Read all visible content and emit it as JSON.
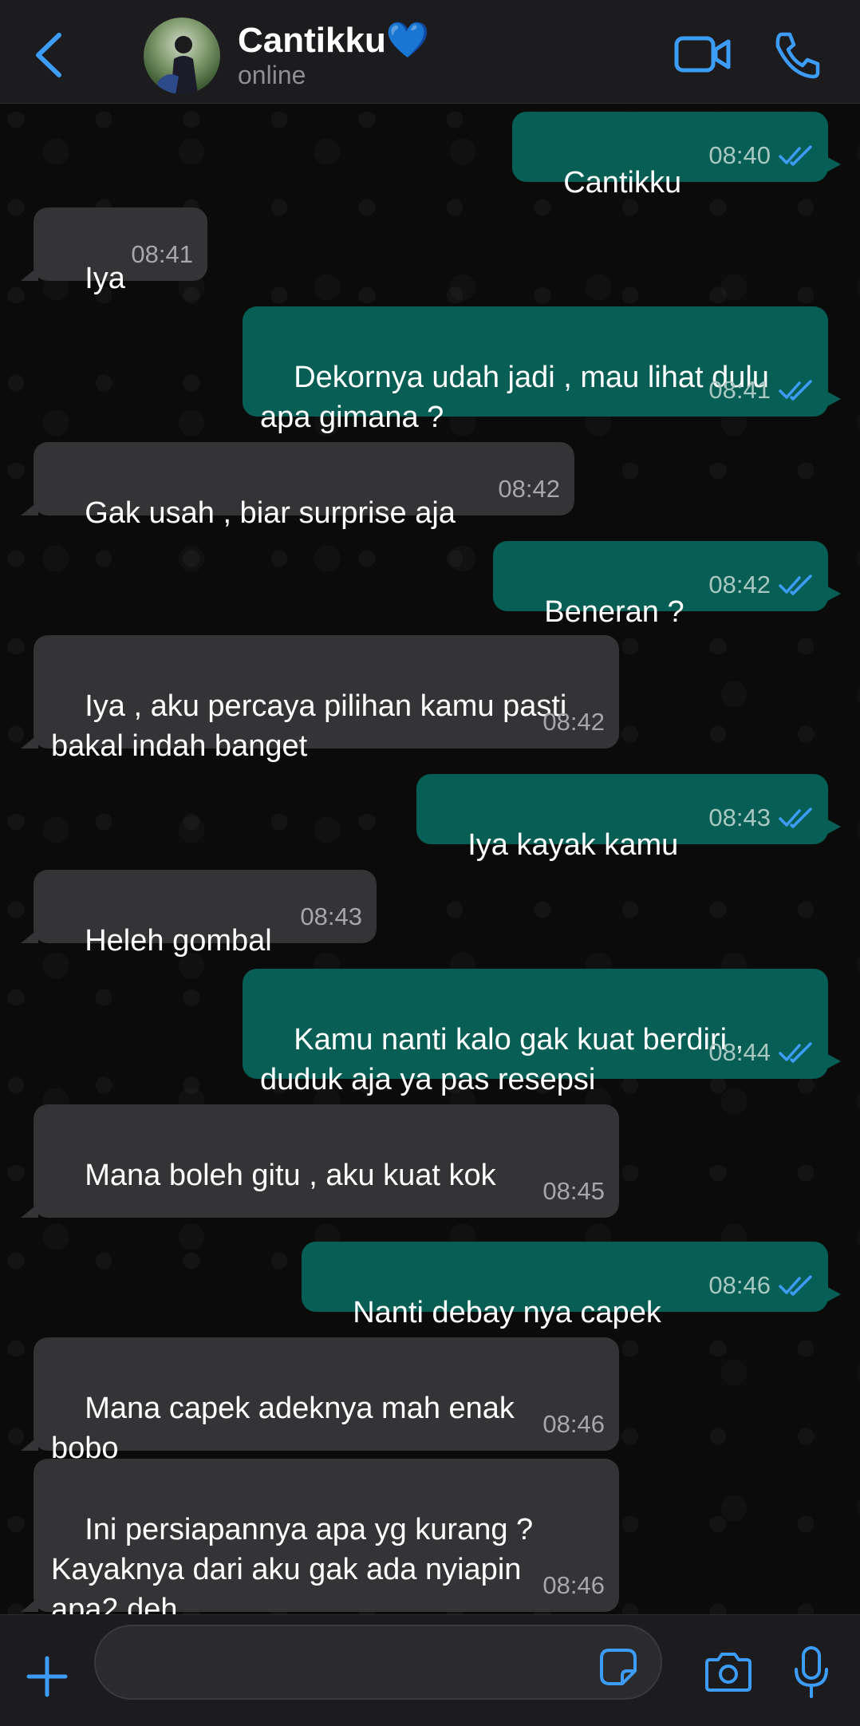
{
  "header": {
    "contact_name": "Cantikku💙",
    "status": "online"
  },
  "colors": {
    "accent": "#3d9df6",
    "outgoing_bubble": "#075e54",
    "incoming_bubble": "#343436"
  },
  "messages": [
    {
      "dir": "out",
      "text": "Cantikku",
      "time": "08:40"
    },
    {
      "dir": "in",
      "text": "Iya",
      "time": "08:41"
    },
    {
      "dir": "out",
      "text": "Dekornya udah jadi , mau lihat dulu\napa gimana ?",
      "time": "08:41"
    },
    {
      "dir": "in",
      "text": "Gak usah , biar surprise aja",
      "time": "08:42"
    },
    {
      "dir": "out",
      "text": "Beneran ?",
      "time": "08:42"
    },
    {
      "dir": "in",
      "text": "Iya , aku percaya pilihan kamu pasti\nbakal indah banget",
      "time": "08:42"
    },
    {
      "dir": "out",
      "text": "Iya kayak kamu",
      "time": "08:43"
    },
    {
      "dir": "in",
      "text": "Heleh gombal",
      "time": "08:43"
    },
    {
      "dir": "out",
      "text": "Kamu nanti kalo gak kuat berdiri ,\nduduk aja ya pas resepsi",
      "time": "08:44"
    },
    {
      "dir": "in",
      "text": "Mana boleh gitu , aku kuat kok",
      "time": "08:45"
    },
    {
      "dir": "out",
      "text": "Nanti debay nya capek",
      "time": "08:46"
    },
    {
      "dir": "in",
      "text": "Mana capek adeknya mah enak\nbobo",
      "time": "08:46"
    },
    {
      "dir": "in",
      "text": "Ini persiapannya apa yg kurang ?\nKayaknya dari aku gak ada nyiapin\napa2 deh",
      "time": "08:46"
    }
  ],
  "composer": {
    "value": ""
  },
  "icons": [
    "back-chevron-icon",
    "video-call-icon",
    "phone-icon",
    "plus-icon",
    "sticker-icon",
    "camera-icon",
    "microphone-icon",
    "double-check-icon"
  ]
}
